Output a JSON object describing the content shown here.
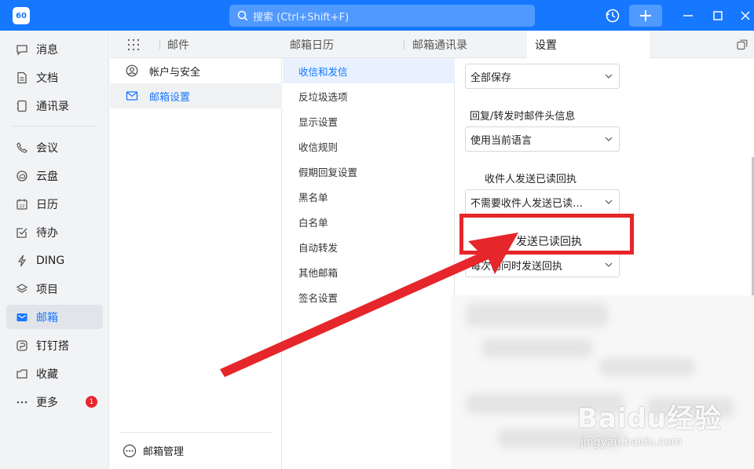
{
  "titlebar": {
    "app_avatar": "60",
    "search_placeholder": "搜索 (Ctrl+Shift+F)",
    "icons": [
      "history-icon",
      "plus-icon",
      "minimize-icon",
      "maximize-icon",
      "close-icon"
    ],
    "bg_color": "#1677ff"
  },
  "leftnav": {
    "items": [
      {
        "label": "消息",
        "icon": "message-icon"
      },
      {
        "label": "文档",
        "icon": "document-icon"
      },
      {
        "label": "通讯录",
        "icon": "contacts-icon"
      },
      {
        "label": "会议",
        "icon": "meeting-icon"
      },
      {
        "label": "云盘",
        "icon": "cloud-drive-icon"
      },
      {
        "label": "日历",
        "icon": "calendar-icon"
      },
      {
        "label": "待办",
        "icon": "todo-icon"
      },
      {
        "label": "DING",
        "icon": "ding-icon"
      },
      {
        "label": "项目",
        "icon": "project-icon"
      },
      {
        "label": "邮箱",
        "icon": "mail-icon",
        "active": true
      },
      {
        "label": "钉钉搭",
        "icon": "dingda-icon"
      },
      {
        "label": "收藏",
        "icon": "favorites-icon"
      },
      {
        "label": "更多",
        "icon": "more-icon"
      }
    ],
    "more_badge": "1"
  },
  "tabs": [
    {
      "label": "邮件"
    },
    {
      "label": "邮箱日历"
    },
    {
      "label": "邮箱通讯录"
    },
    {
      "label": "设置",
      "active": true
    }
  ],
  "settings_nav": {
    "items": [
      {
        "label": "帐户与安全",
        "icon": "user-circle-icon"
      },
      {
        "label": "邮箱设置",
        "icon": "mail-icon",
        "active": true
      }
    ],
    "footer": "邮箱管理"
  },
  "settings_sub_nav": {
    "items": [
      {
        "label": "收信和发信",
        "active": true
      },
      {
        "label": "反垃圾选项"
      },
      {
        "label": "显示设置"
      },
      {
        "label": "收信规则"
      },
      {
        "label": "假期回复设置"
      },
      {
        "label": "黑名单"
      },
      {
        "label": "白名单"
      },
      {
        "label": "自动转发"
      },
      {
        "label": "其他邮箱"
      },
      {
        "label": "签名设置"
      }
    ]
  },
  "content": {
    "save_select": "全部保存",
    "reply_header_label": "回复/转发时邮件头信息",
    "reply_header_select": "使用当前语言",
    "read_receipt_label": "收件人发送已读回执",
    "read_receipt_select": "不需要收件人发送已读…",
    "send_receipt_label": "发送已读回执",
    "send_receipt_select": "每次询问时发送回执"
  },
  "annotation": {
    "box_color": "#e5262b",
    "arrow_color": "#e5262b"
  },
  "watermark": {
    "brand": "Baidu经验",
    "url": "jingyan.baidu.com"
  }
}
